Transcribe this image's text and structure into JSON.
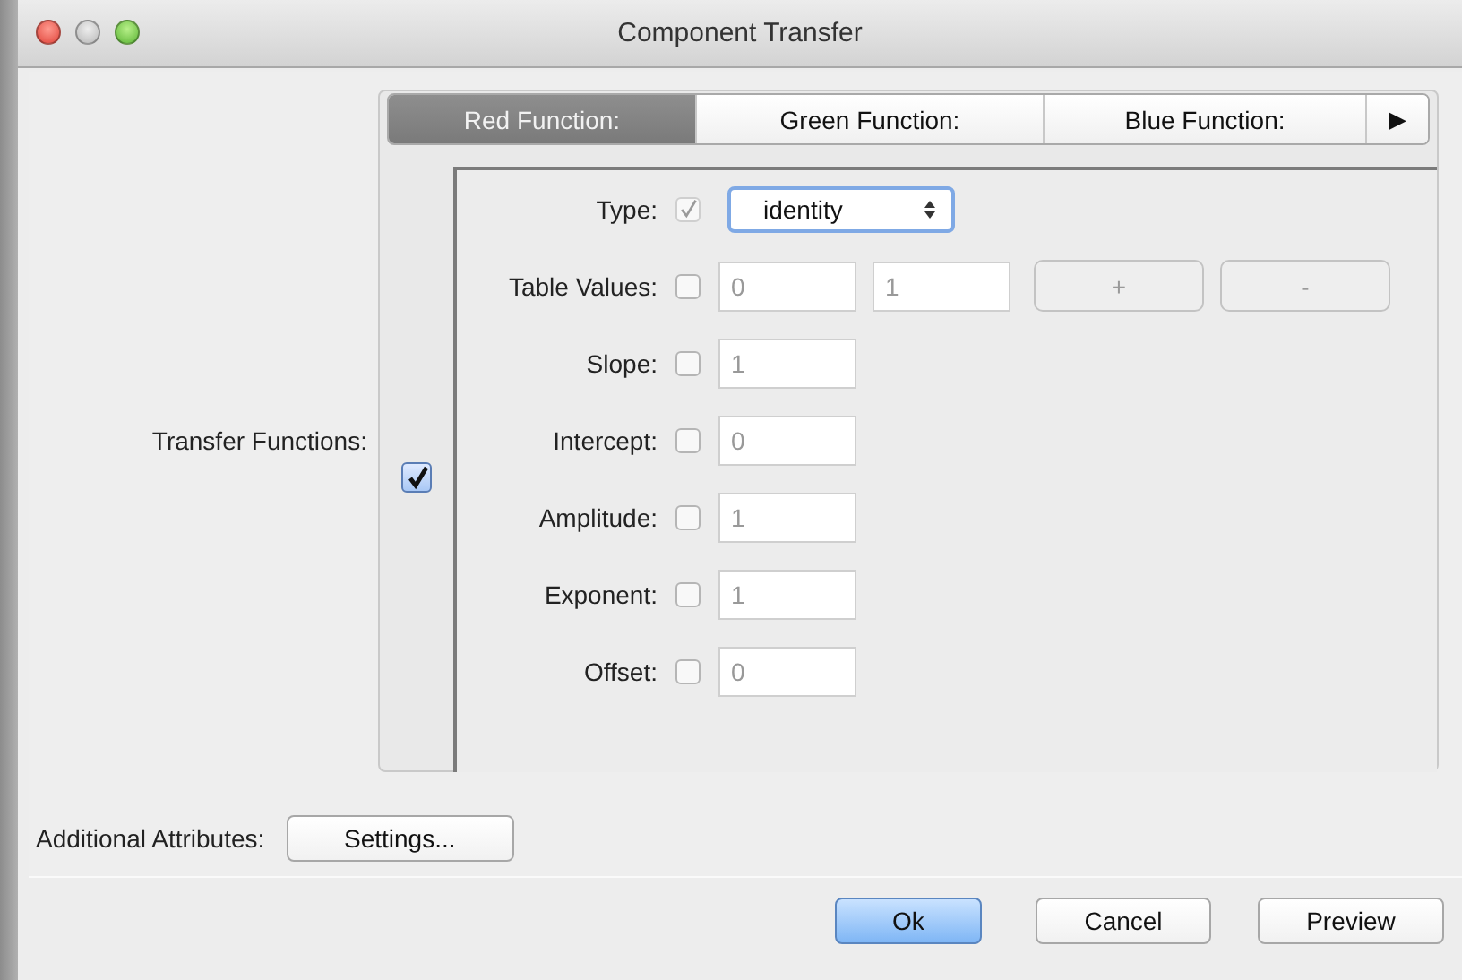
{
  "window": {
    "title": "Component Transfer"
  },
  "transfer_functions": {
    "label": "Transfer Functions:",
    "checked": true,
    "tabs": [
      {
        "label": "Red Function:",
        "selected": true
      },
      {
        "label": "Green Function:",
        "selected": false
      },
      {
        "label": "Blue Function:",
        "selected": false
      }
    ],
    "more_tabs": "▶",
    "rows": [
      {
        "kind": "select",
        "label": "Type:",
        "checked": true,
        "value": "identity"
      },
      {
        "kind": "table",
        "label": "Table Values:",
        "checked": false,
        "values": [
          "0",
          "1"
        ],
        "buttons": [
          "+",
          "-"
        ]
      },
      {
        "kind": "number",
        "label": "Slope:",
        "checked": false,
        "value": "1"
      },
      {
        "kind": "number",
        "label": "Intercept:",
        "checked": false,
        "value": "0"
      },
      {
        "kind": "number",
        "label": "Amplitude:",
        "checked": false,
        "value": "1"
      },
      {
        "kind": "number",
        "label": "Exponent:",
        "checked": false,
        "value": "1"
      },
      {
        "kind": "number",
        "label": "Offset:",
        "checked": false,
        "value": "0"
      }
    ]
  },
  "additional_attributes": {
    "label": "Additional Attributes:",
    "button": "Settings..."
  },
  "buttons": [
    {
      "label": "Ok",
      "default": true
    },
    {
      "label": "Cancel",
      "default": false
    },
    {
      "label": "Preview",
      "default": false
    }
  ]
}
